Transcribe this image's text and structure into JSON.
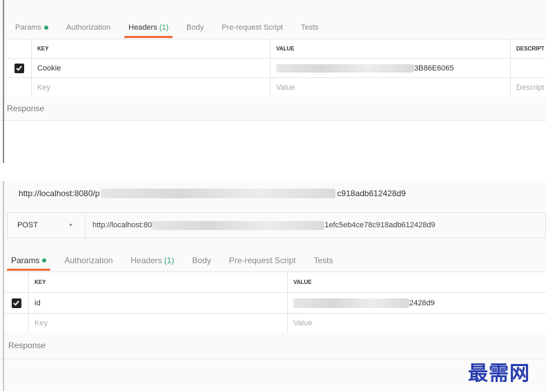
{
  "top_panel": {
    "tabs": [
      {
        "label": "Params",
        "dot": true
      },
      {
        "label": "Authorization"
      },
      {
        "label": "Headers",
        "count": "(1)",
        "active": true
      },
      {
        "label": "Body"
      },
      {
        "label": "Pre-request Script"
      },
      {
        "label": "Tests"
      }
    ],
    "columns": [
      "KEY",
      "VALUE",
      "DESCRIPT"
    ],
    "row": {
      "key": "Cookie",
      "value_visible": "3B86E6065",
      "checked": true
    },
    "empty_row": {
      "key_placeholder": "Key",
      "value_placeholder": "Value",
      "desc_placeholder": "Descript"
    },
    "response_label": "Response"
  },
  "bottom_panel": {
    "url_title_left": "http://localhost:8080/p",
    "url_title_right": "c918adb612428d9",
    "method": "POST",
    "url_input_left": "http://localhost:80",
    "url_input_right": "1efc5eb4ce78c918adb612428d9",
    "tabs": [
      {
        "label": "Params",
        "dot": true,
        "active": true
      },
      {
        "label": "Authorization"
      },
      {
        "label": "Headers",
        "count": "(1)"
      },
      {
        "label": "Body"
      },
      {
        "label": "Pre-request Script"
      },
      {
        "label": "Tests"
      }
    ],
    "columns": [
      "KEY",
      "VALUE"
    ],
    "row": {
      "key": "id",
      "value_visible": "2428d9",
      "checked": true
    },
    "empty_row": {
      "key_placeholder": "Key",
      "value_placeholder": "Value"
    },
    "response_label": "Response"
  },
  "watermark": "最需网",
  "colors": {
    "accent": "#f26b3a",
    "green": "#2ea36f",
    "watermark": "#2a3fae"
  }
}
